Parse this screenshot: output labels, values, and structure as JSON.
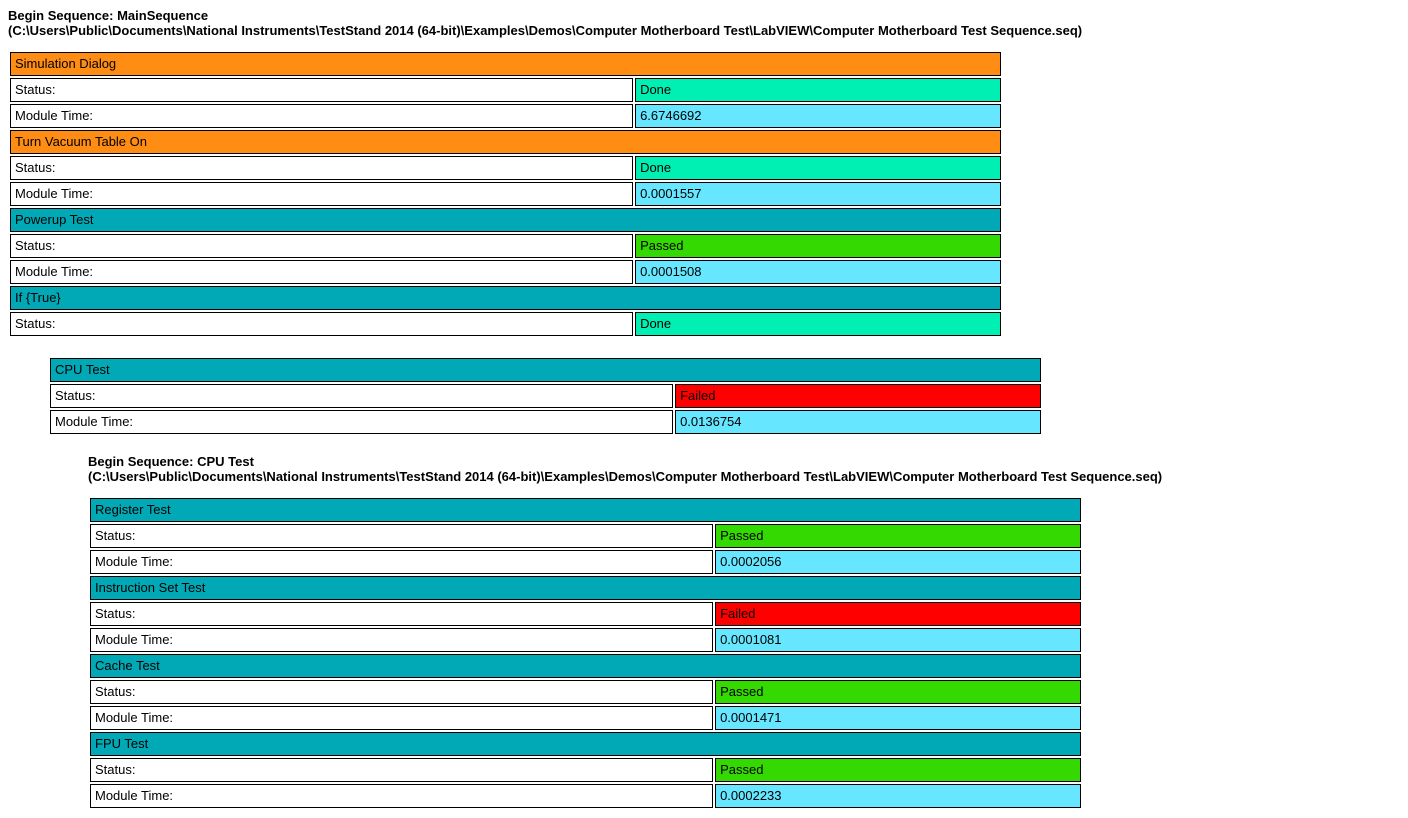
{
  "seq1": {
    "heading_line1": "Begin Sequence: MainSequence",
    "heading_line2": "(C:\\Users\\Public\\Documents\\National Instruments\\TestStand 2014 (64-bit)\\Examples\\Demos\\Computer Motherboard Test\\LabVIEW\\Computer Motherboard Test Sequence.seq)",
    "labels": {
      "status": "Status:",
      "moduletime": "Module Time:"
    },
    "steps": [
      {
        "name": "Simulation Dialog",
        "name_bg": "bg-orange",
        "status": "Done",
        "status_bg": "bg-mint",
        "moduletime": "6.6746692",
        "mt_bg": "bg-cyan"
      },
      {
        "name": "Turn Vacuum Table On",
        "name_bg": "bg-orange",
        "status": "Done",
        "status_bg": "bg-mint",
        "moduletime": "0.0001557",
        "mt_bg": "bg-cyan"
      },
      {
        "name": "Powerup Test",
        "name_bg": "bg-teal",
        "status": "Passed",
        "status_bg": "bg-green",
        "moduletime": "0.0001508",
        "mt_bg": "bg-cyan"
      },
      {
        "name": "If {True}",
        "name_bg": "bg-teal",
        "status": "Done",
        "status_bg": "bg-mint"
      }
    ],
    "steps_indented": [
      {
        "name": "CPU Test",
        "name_bg": "bg-teal",
        "status": "Failed",
        "status_bg": "bg-red",
        "moduletime": "0.0136754",
        "mt_bg": "bg-cyan"
      }
    ]
  },
  "seq2": {
    "heading_line1": "Begin Sequence: CPU Test",
    "heading_line2": "(C:\\Users\\Public\\Documents\\National Instruments\\TestStand 2014 (64-bit)\\Examples\\Demos\\Computer Motherboard Test\\LabVIEW\\Computer Motherboard Test Sequence.seq)",
    "labels": {
      "status": "Status:",
      "moduletime": "Module Time:"
    },
    "steps": [
      {
        "name": "Register Test",
        "name_bg": "bg-teal",
        "status": "Passed",
        "status_bg": "bg-green",
        "moduletime": "0.0002056",
        "mt_bg": "bg-cyan"
      },
      {
        "name": "Instruction Set Test",
        "name_bg": "bg-teal",
        "status": "Failed",
        "status_bg": "bg-red",
        "moduletime": "0.0001081",
        "mt_bg": "bg-cyan"
      },
      {
        "name": "Cache Test",
        "name_bg": "bg-teal",
        "status": "Passed",
        "status_bg": "bg-green",
        "moduletime": "0.0001471",
        "mt_bg": "bg-cyan"
      },
      {
        "name": "FPU Test",
        "name_bg": "bg-teal",
        "status": "Passed",
        "status_bg": "bg-green",
        "moduletime": "0.0002233",
        "mt_bg": "bg-cyan"
      }
    ]
  }
}
